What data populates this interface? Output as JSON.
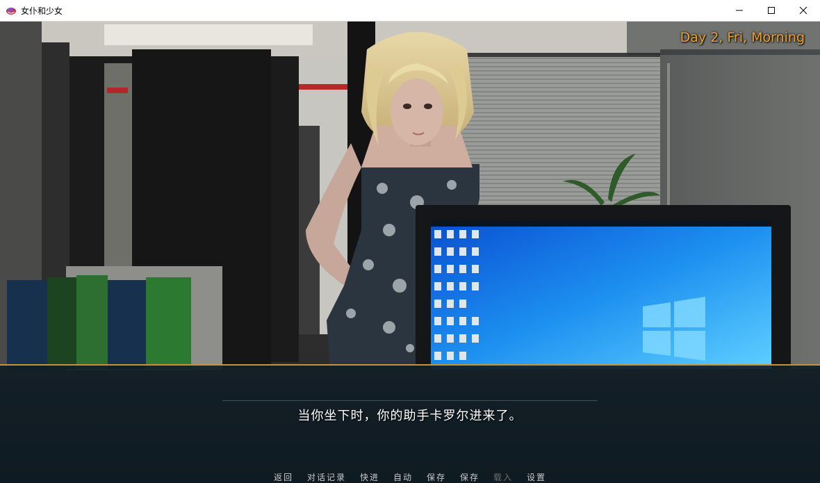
{
  "window": {
    "title": "女仆和少女",
    "controls": [
      "minimize-icon",
      "maximize-icon",
      "close-icon"
    ]
  },
  "hud": {
    "time_label": "Day 2, Fri, Morning",
    "time_color": "#f0a030"
  },
  "dialogue": {
    "text": "当你坐下时，你的助手卡罗尔进来了。"
  },
  "quick_menu": {
    "items": [
      {
        "label": "返回",
        "enabled": true
      },
      {
        "label": "对话记录",
        "enabled": true
      },
      {
        "label": "快进",
        "enabled": true
      },
      {
        "label": "自动",
        "enabled": true
      },
      {
        "label": "保存",
        "enabled": true
      },
      {
        "label": "保存",
        "enabled": true
      },
      {
        "label": "载入",
        "enabled": false
      },
      {
        "label": "设置",
        "enabled": true
      }
    ]
  },
  "colors": {
    "textbox_border": "#c8913a",
    "textbox_bg": "#121e26"
  }
}
